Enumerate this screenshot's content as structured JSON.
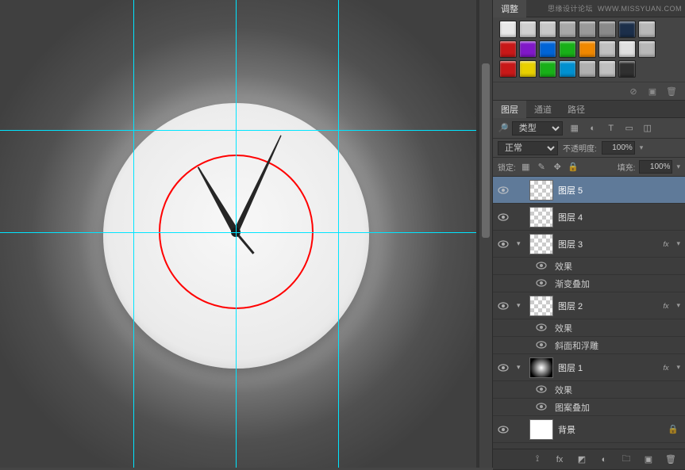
{
  "watermark": {
    "site_cn": "思缘设计论坛",
    "site_url": "WWW.MISSYUAN.COM"
  },
  "adjustments": {
    "tab_label": "调整"
  },
  "styles": {
    "row1_colors": [
      "#e8e8e8",
      "#d0d0d0",
      "#c8c8c8",
      "#a8a8a8",
      "#9a9a9a",
      "#8a8a8a",
      "#1c2f4a",
      "#b8b8b8"
    ],
    "row2_colors": [
      "#c81818",
      "#8018c8",
      "#0064d6",
      "#18b018",
      "#f08800",
      "#c0c0c0",
      "#e0e0e0",
      "#b8b8b8"
    ],
    "row3_colors": [
      "#c81818",
      "#e8d000",
      "#18b018",
      "#0090d0",
      "#b0b0b0",
      "#c0c0c0",
      "#303030"
    ]
  },
  "layers_panel": {
    "tabs": {
      "layers": "图层",
      "channels": "通道",
      "paths": "路径"
    },
    "filter_kind": "类型",
    "blend_mode": "正常",
    "opacity_label": "不透明度:",
    "opacity_value": "100%",
    "lock_label": "锁定:",
    "fill_label": "填充:",
    "fill_value": "100%"
  },
  "layers": [
    {
      "id": "l5",
      "name": "图层 5",
      "visible": true,
      "selected": true,
      "thumb": "checker"
    },
    {
      "id": "l4",
      "name": "图层 4",
      "visible": true,
      "thumb": "checker"
    },
    {
      "id": "l3",
      "name": "图层 3",
      "visible": true,
      "thumb": "checker",
      "fx": [
        "效果",
        "渐变叠加"
      ]
    },
    {
      "id": "l2",
      "name": "图层 2",
      "visible": true,
      "thumb": "checker",
      "fx": [
        "效果",
        "斜面和浮雕"
      ]
    },
    {
      "id": "l1",
      "name": "图层 1",
      "visible": true,
      "thumb": "radial",
      "fx": [
        "效果",
        "图案叠加"
      ]
    },
    {
      "id": "bg",
      "name": "背景",
      "visible": true,
      "thumb": "bg-white",
      "locked": true
    }
  ],
  "fx_label": "fx"
}
